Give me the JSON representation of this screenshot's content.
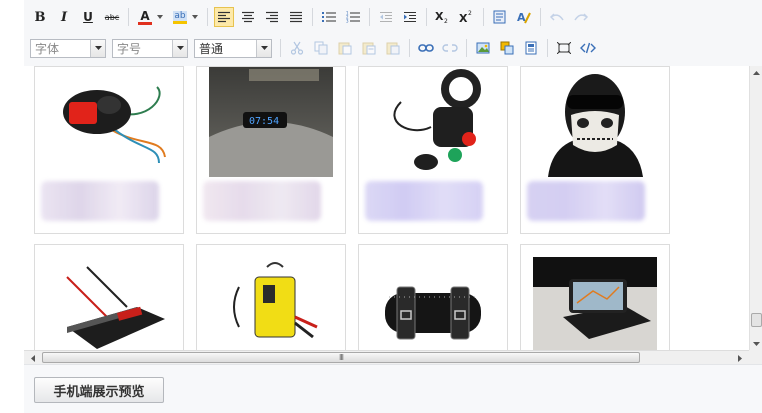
{
  "toolbar": {
    "font_family_placeholder": "字体",
    "font_size_placeholder": "字号",
    "paragraph_format_value": "普通",
    "bold_glyph": "B",
    "italic_glyph": "I",
    "underline_glyph": "U",
    "strike_glyph": "abc",
    "fore_color_glyph": "A",
    "back_color_glyph": "ab",
    "colors": {
      "fore_color": "#e0301e",
      "back_color": "#f5c400",
      "active_bg": "#fde9a9",
      "icon_blue": "#3a6fb7"
    }
  },
  "products": [
    {
      "name": "handlebar-switch-product",
      "placeholder_color": "#d9cfe6"
    },
    {
      "name": "dashboard-clock-product",
      "placeholder_color": "#e2d6e8"
    },
    {
      "name": "handlebar-throttle-switch-product",
      "placeholder_color": "#c9c3f2"
    },
    {
      "name": "skull-face-mask-product",
      "placeholder_color": "#cdc6f0"
    },
    {
      "name": "power-inverter-product"
    },
    {
      "name": "battery-charger-product"
    },
    {
      "name": "leather-tool-bag-product"
    },
    {
      "name": "phone-mount-product"
    }
  ],
  "footer": {
    "mobile_preview_label": "手机端展示预览"
  },
  "scrollbar": {
    "hscroll_grip": "III"
  }
}
